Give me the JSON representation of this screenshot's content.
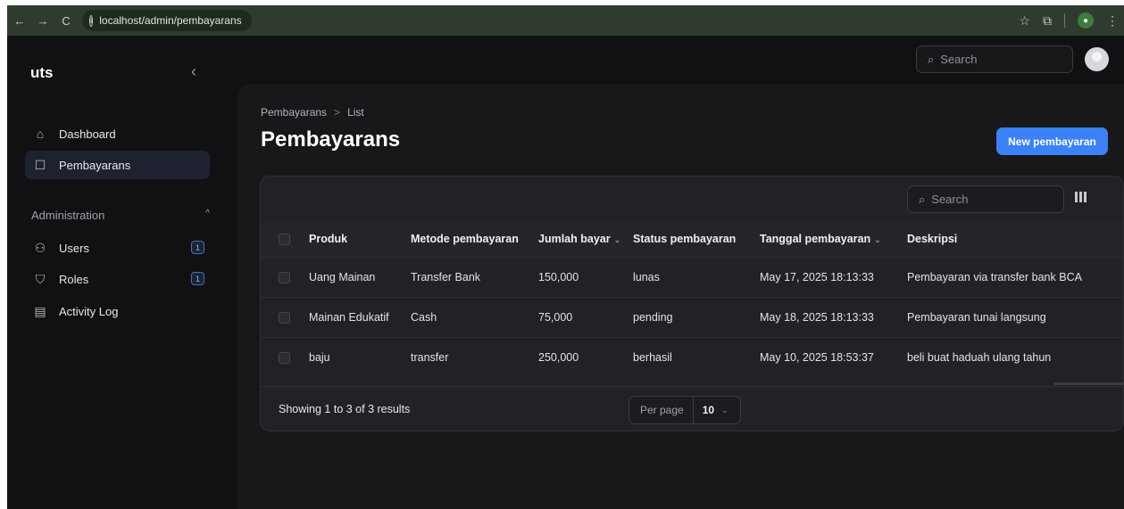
{
  "browser": {
    "url": "localhost/admin/pembayarans",
    "back_icon": "←",
    "forward_icon": "→",
    "reload_icon": "C",
    "star_icon": "☆",
    "extension_icon": "⧉",
    "menu_icon": "⋮"
  },
  "sidebar": {
    "brand": "uts",
    "collapse_icon": "‹",
    "items": [
      {
        "label": "Dashboard",
        "icon": "⌂"
      },
      {
        "label": "Pembayarans",
        "icon": "☐"
      }
    ],
    "group_label": "Administration",
    "group_chevron": "^",
    "admin_items": [
      {
        "label": "Users",
        "icon": "⚇",
        "badge": "1"
      },
      {
        "label": "Roles",
        "icon": "⛉",
        "badge": "1"
      },
      {
        "label": "Activity Log",
        "icon": "▤"
      }
    ]
  },
  "topbar": {
    "search_placeholder": "Search",
    "search_icon": "⌕"
  },
  "page": {
    "breadcrumb": [
      "Pembayarans",
      "List"
    ],
    "breadcrumb_sep": ">",
    "title": "Pembayarans",
    "new_button": "New pembayaran"
  },
  "table": {
    "search_placeholder": "Search",
    "columns": [
      "Produk",
      "Metode pembayaran",
      "Jumlah bayar",
      "Status pembayaran",
      "Tanggal pembayaran",
      "Deskripsi"
    ],
    "sort_icon": "⌄",
    "rows": [
      [
        "Uang Mainan",
        "Transfer Bank",
        "150,000",
        "lunas",
        "May 17, 2025 18:13:33",
        "Pembayaran via transfer bank BCA"
      ],
      [
        "Mainan Edukatif",
        "Cash",
        "75,000",
        "pending",
        "May 18, 2025 18:13:33",
        "Pembayaran tunai langsung"
      ],
      [
        "baju",
        "transfer",
        "250,000",
        "berhasil",
        "May 10, 2025 18:53:37",
        "beli buat haduah ulang tahun"
      ]
    ],
    "showing": "Showing 1 to 3 of 3 results",
    "per_page_label": "Per page",
    "per_page_value": "10",
    "per_page_chevron": "⌄"
  },
  "colors": {
    "accent": "#3b82f6",
    "background": "#111113",
    "panel": "#18181b",
    "card": "#222226"
  }
}
